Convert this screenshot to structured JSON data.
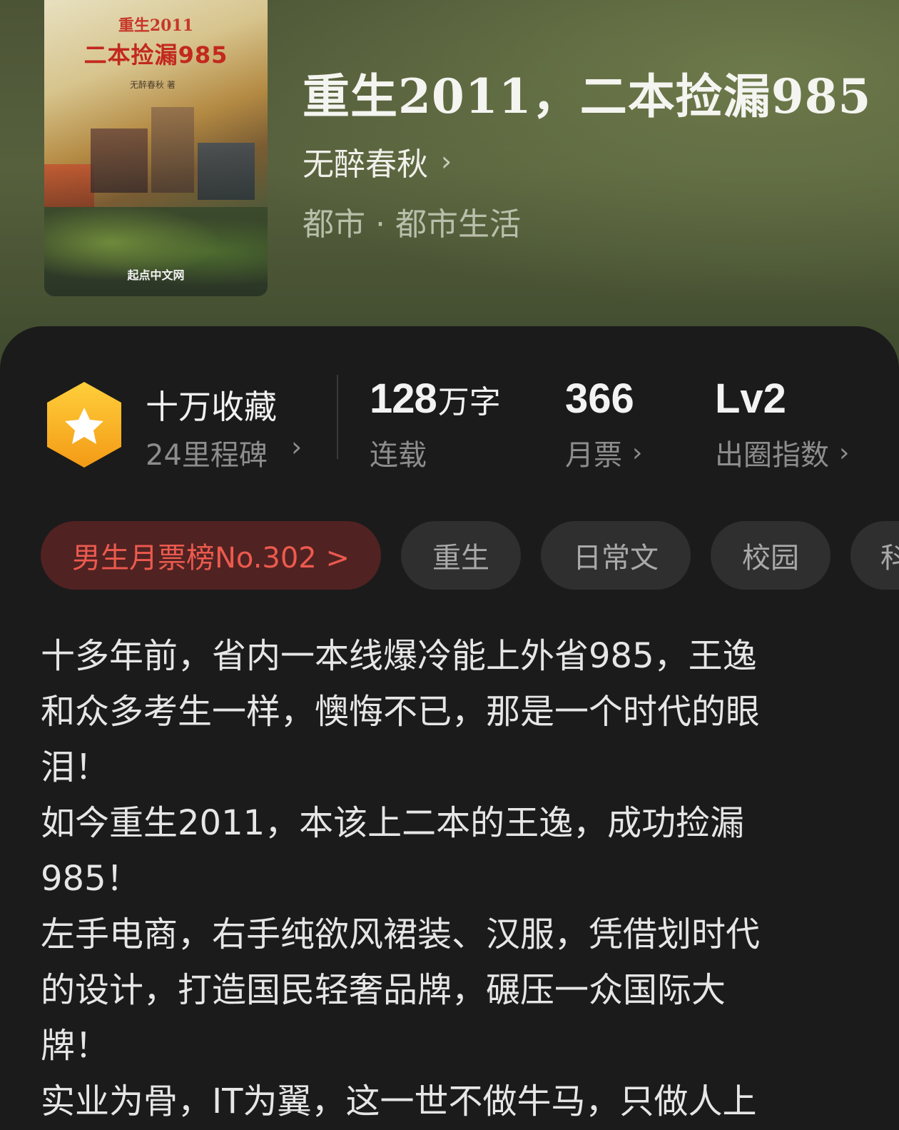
{
  "hero": {
    "cover": {
      "title_line1": "重生2011",
      "title_line2": "二本捡漏985",
      "author_line": "无醉春秋 著",
      "publisher": "起点中文网"
    },
    "title": "重生2011，二本捡漏985",
    "author": "无醉春秋",
    "genre": "都市 · 都市生活"
  },
  "stats": {
    "collect": {
      "label": "十万收藏",
      "sub": "24里程碑",
      "icon": "star-badge-icon"
    },
    "words": {
      "value": "128",
      "unit": "万字",
      "label": "连载"
    },
    "monthly_tickets": {
      "value": "366",
      "label": "月票"
    },
    "index": {
      "value": "Lv2",
      "label": "出圈指数"
    }
  },
  "tags": {
    "rank": "男生月票榜No.302 >",
    "items": [
      "重生",
      "日常文",
      "校园",
      "科"
    ]
  },
  "description": "十多年前，省内一本线爆冷能上外省985，王逸\n和众多考生一样，懊悔不已，那是一个时代的眼\n泪！\n如今重生2011，本该上二本的王逸，成功捡漏\n985！\n左手电商，右手纯欲风裙装、汉服，凭借划时代\n的设计，打造国民轻奢品牌，碾压一众国际大\n牌！\n实业为骨，IT为翼，这一世不做牛马，只做人上",
  "colors": {
    "background": "#1b1b1b",
    "hero_green": "#56603d",
    "badge_orange": "#f5a623",
    "rank_red": "#ec5a4e"
  }
}
